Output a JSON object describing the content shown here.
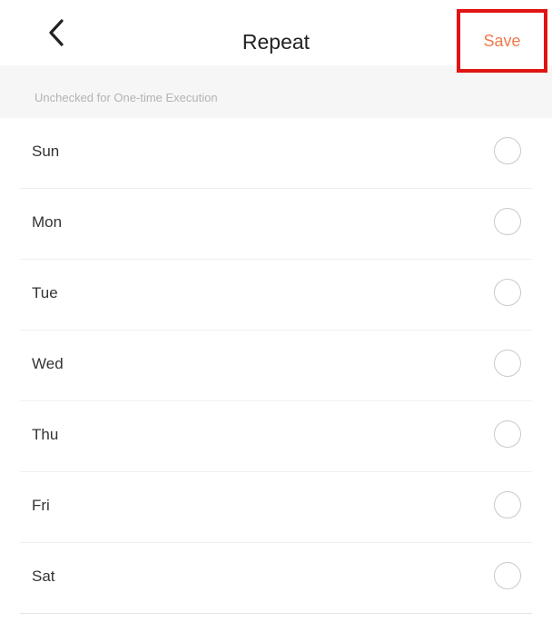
{
  "header": {
    "title": "Repeat",
    "back_icon": "chevron-left-icon",
    "save_label": "Save",
    "save_color": "#f07a4c",
    "highlight_color": "#e01414"
  },
  "hint": {
    "text": "Unchecked for One-time Execution"
  },
  "days": [
    {
      "label": "Sun",
      "checked": false
    },
    {
      "label": "Mon",
      "checked": false
    },
    {
      "label": "Tue",
      "checked": false
    },
    {
      "label": "Wed",
      "checked": false
    },
    {
      "label": "Thu",
      "checked": false
    },
    {
      "label": "Fri",
      "checked": false
    },
    {
      "label": "Sat",
      "checked": false
    }
  ]
}
